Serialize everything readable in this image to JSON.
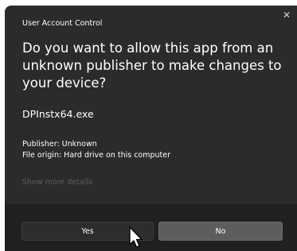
{
  "dialog": {
    "title": "User Account Control",
    "close_glyph": "✕",
    "question": "Do you want to allow this app from an unknown publisher to make changes to your device?",
    "app_name": "DPInstx64.exe",
    "publisher": "Publisher: Unknown",
    "file_origin": "File origin: Hard drive on this computer",
    "more_details": "Show more details",
    "yes_label": "Yes",
    "no_label": "No"
  },
  "colors": {
    "dialog_background": "#2b2b2b",
    "footer_background": "#202020",
    "no_button": "#5d5d5d",
    "yes_button": "#2d2d2d",
    "muted_text": "#5e5e5e"
  },
  "icons": {
    "close": "close-icon",
    "cursor": "cursor-icon"
  }
}
